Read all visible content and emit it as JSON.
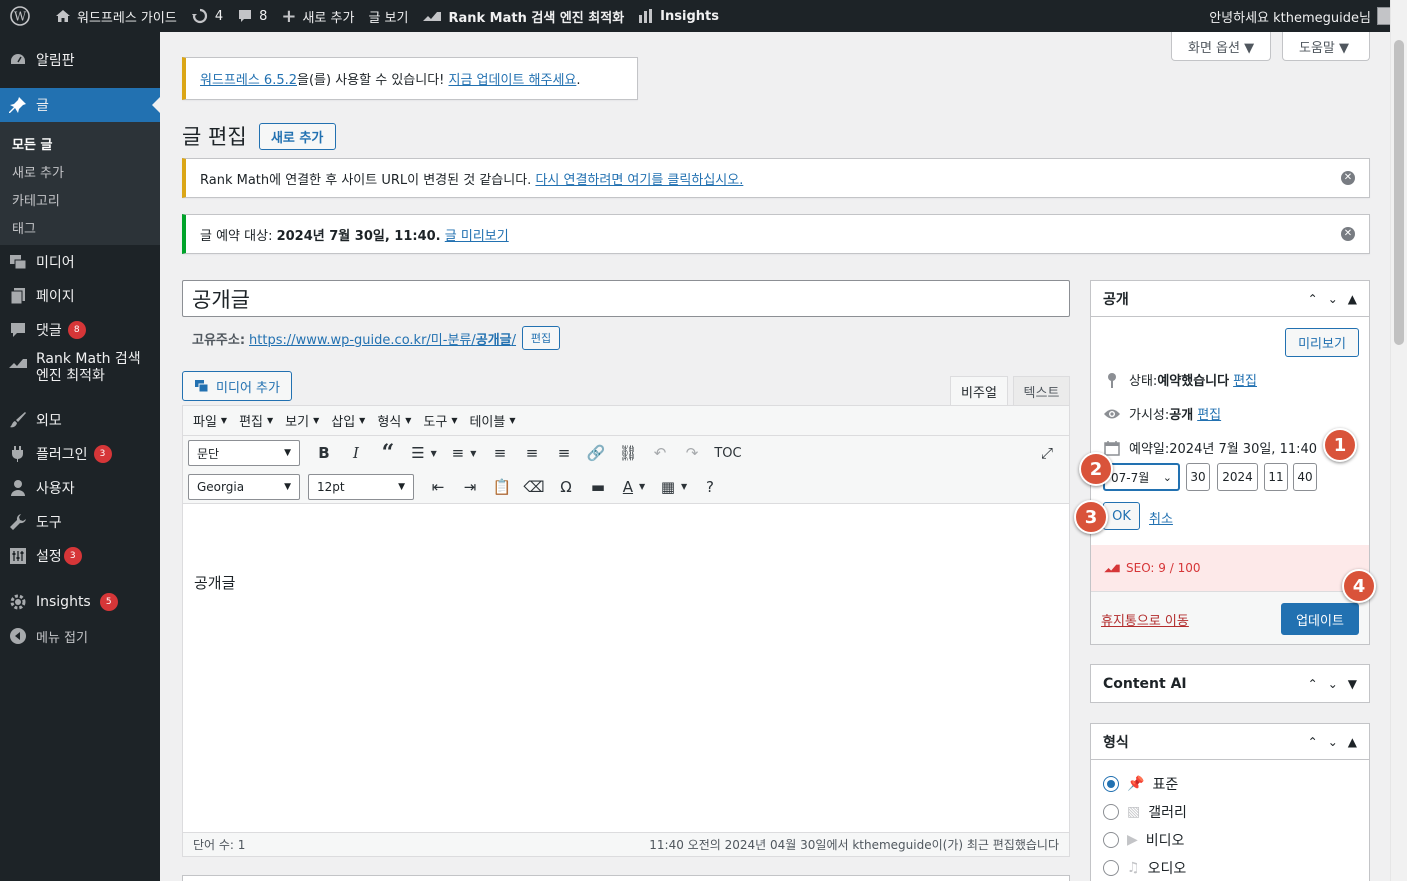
{
  "adminbar": {
    "site_name": "워드프레스 가이드",
    "updates_count": "4",
    "comments_count": "8",
    "new_label": "새로 추가",
    "view_post": "글 보기",
    "rankmath_label": "Rank Math 검색 엔진 최적화",
    "insights_label": "Insights",
    "greeting": "안녕하세요 kthemeguide님"
  },
  "sidebar": {
    "dashboard": "알림판",
    "posts": "글",
    "posts_sub": [
      "모든 글",
      "새로 추가",
      "카테고리",
      "태그"
    ],
    "media": "미디어",
    "pages": "페이지",
    "comments": "댓글",
    "comments_badge": "8",
    "rankmath_line1": "Rank Math 검색",
    "rankmath_line2": "엔진 최적화",
    "appearance": "외모",
    "plugins": "플러그인",
    "plugins_badge": "3",
    "users": "사용자",
    "tools": "도구",
    "settings": "설정",
    "settings_badge": "3",
    "insights": "Insights",
    "insights_badge": "5",
    "collapse": "메뉴 접기"
  },
  "screen_meta": {
    "options": "화면 옵션 ▼",
    "help": "도움말 ▼"
  },
  "update_notice": {
    "link1": "워드프레스 6.5.2",
    "text": "을(를) 사용할 수 있습니다! ",
    "link2": "지금 업데이트 해주세요",
    "end": "."
  },
  "page": {
    "title": "글 편집",
    "add_new": "새로 추가"
  },
  "rankmath_notice": {
    "text": "Rank Math에 연결한 후 사이트 URL이 변경된 것 같습니다. ",
    "link": "다시 연결하려면 여기를 클릭하십시오."
  },
  "scheduled_notice": {
    "text": "글 예약 대상: ",
    "date": "2024년 7월 30일, 11:40.",
    "link": "글 미리보기"
  },
  "editor": {
    "post_title": "공개글",
    "permalink_label": "고유주소:",
    "permalink_url_base": "https://www.wp-guide.co.kr/미-분류/",
    "permalink_slug": "공개글",
    "permalink_slash": "/",
    "permalink_edit": "편집",
    "add_media": "미디어 추가",
    "tab_visual": "비주얼",
    "tab_text": "텍스트",
    "menus": [
      "파일",
      "편집",
      "보기",
      "삽입",
      "형식",
      "도구",
      "테이블"
    ],
    "format_select": "문단",
    "font_select": "Georgia",
    "size_select": "12pt",
    "toc_label": "TOC",
    "content": "공개글",
    "word_count": "단어 수: 1",
    "last_edited": "11:40 오전의 2024년 04월 30일에서 kthemeguide이(가) 최근 편집했습니다"
  },
  "publish": {
    "title": "공개",
    "preview": "미리보기",
    "status_label": "상태: ",
    "status_value": "예약했습니다",
    "status_edit": "편집",
    "visibility_label": "가시성: ",
    "visibility_value": "공개",
    "visibility_edit": "편집",
    "schedule_label": "예약일: ",
    "schedule_value": "2024년 7월 30일, 11:40",
    "month": "07-7월",
    "day": "30",
    "year": "2024",
    "hour": "11",
    "minute": "40",
    "ok": "OK",
    "cancel": "취소",
    "seo": "SEO: 9 / 100",
    "trash": "휴지통으로 이동",
    "update": "업데이트"
  },
  "content_ai": {
    "title": "Content AI"
  },
  "format_box": {
    "title": "형식",
    "options": [
      "표준",
      "갤러리",
      "비디오",
      "오디오"
    ]
  },
  "markers": [
    "1",
    "2",
    "3",
    "4"
  ],
  "colors": {
    "adminbar": "#1d2327",
    "accent": "#2271b1",
    "marker": "#d9533a",
    "seo_bg": "#fde9e9",
    "seo_text": "#d63638"
  }
}
